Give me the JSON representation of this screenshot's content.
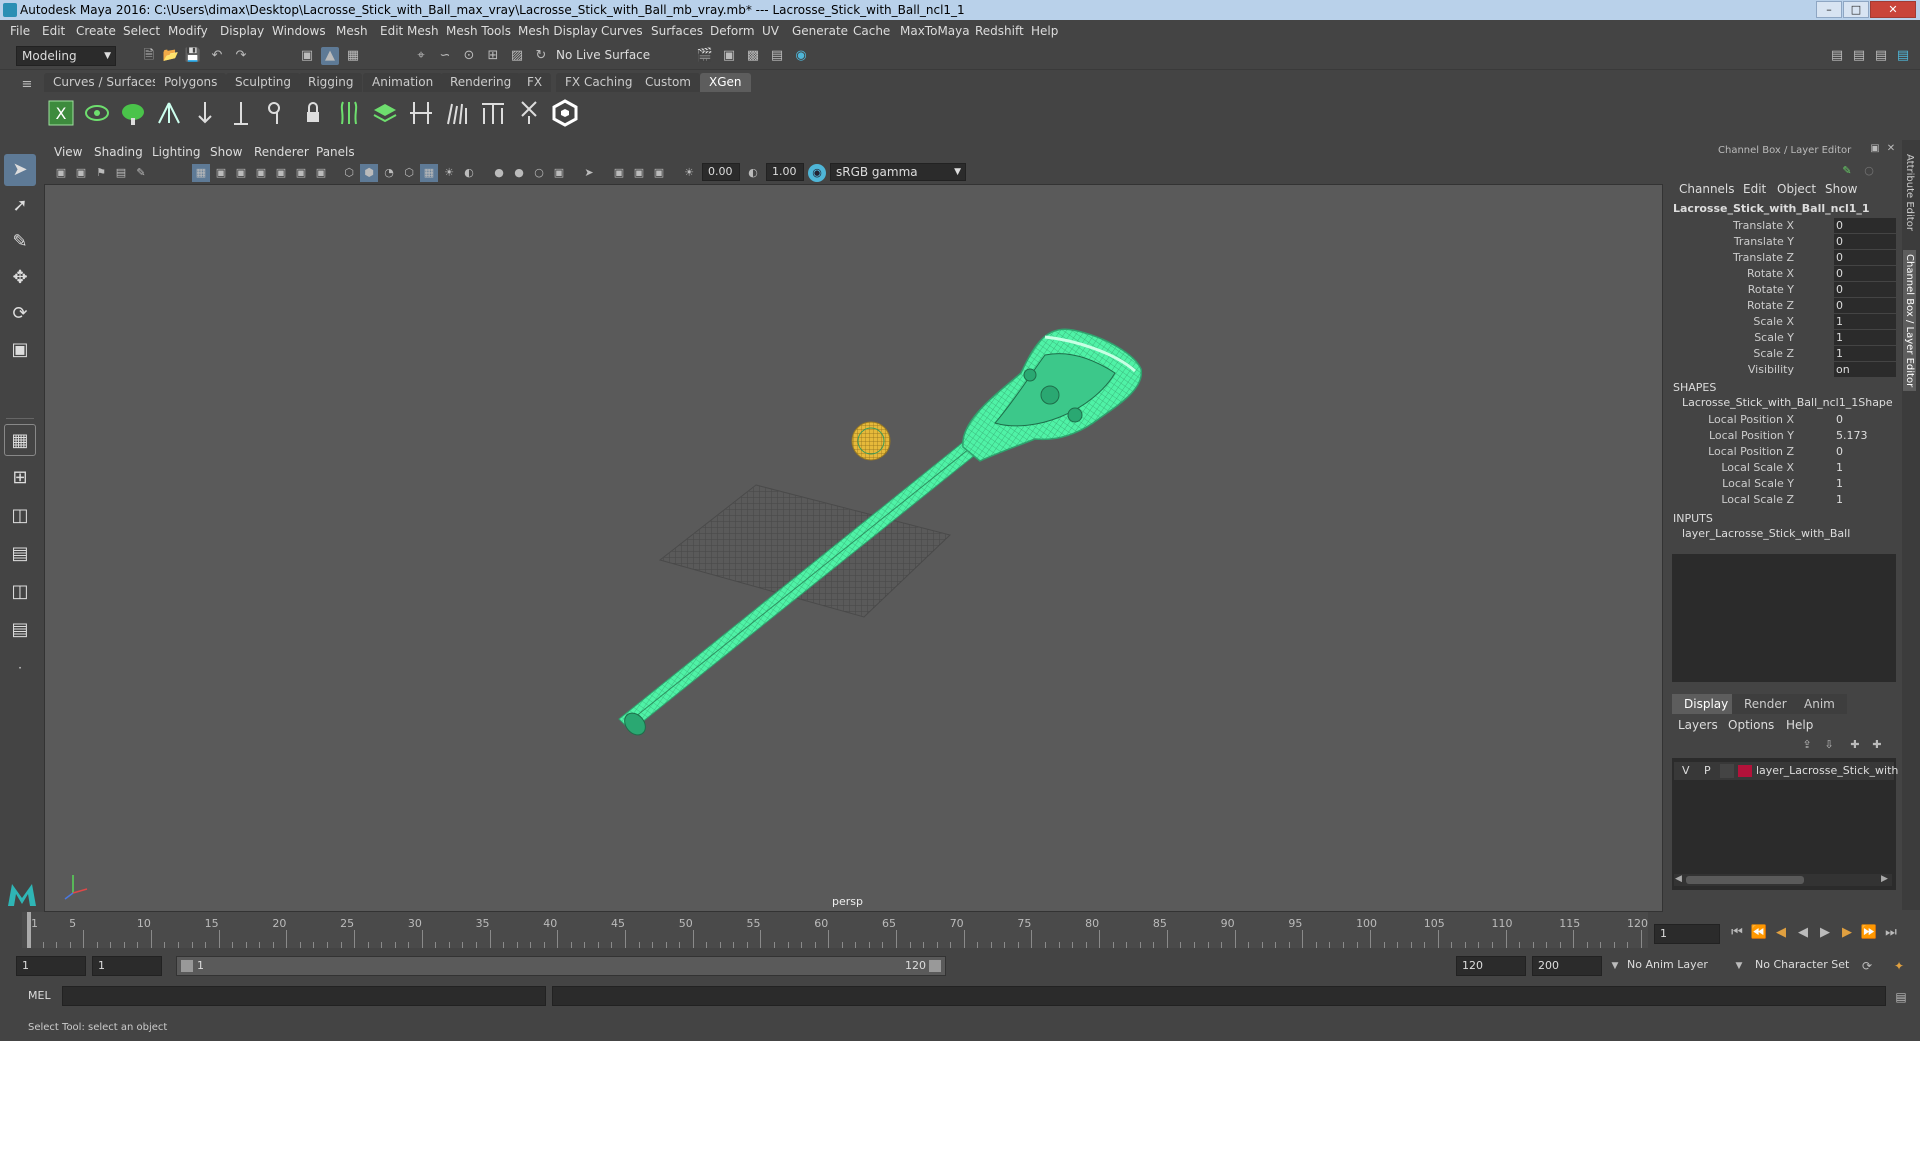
{
  "window": {
    "title": "Autodesk Maya 2016: C:\\Users\\dimax\\Desktop\\Lacrosse_Stick_with_Ball_max_vray\\Lacrosse_Stick_with_Ball_mb_vray.mb*   ---   Lacrosse_Stick_with_Ball_ncl1_1"
  },
  "menu": [
    "File",
    "Edit",
    "Create",
    "Select",
    "Modify",
    "Display",
    "Windows",
    "Mesh",
    "Edit Mesh",
    "Mesh Tools",
    "Mesh Display",
    "Curves",
    "Surfaces",
    "Deform",
    "UV",
    "Generate",
    "Cache",
    "MaxToMaya",
    "Redshift",
    "Help"
  ],
  "statusline": {
    "mode": "Modeling",
    "live_surface": "No Live Surface"
  },
  "shelf_tabs": [
    "Curves / Surfaces",
    "Polygons",
    "Sculpting",
    "Rigging",
    "Animation",
    "Rendering",
    "FX",
    "FX Caching",
    "Custom",
    "XGen"
  ],
  "shelf_active": "XGen",
  "panel_menu": [
    "View",
    "Shading",
    "Lighting",
    "Show",
    "Renderer",
    "Panels"
  ],
  "panel_toolbar": {
    "exposure": "0.00",
    "gamma": "1.00",
    "color_space": "sRGB gamma"
  },
  "viewport": {
    "camera_label": "persp"
  },
  "channel_box": {
    "header": "Channel Box / Layer Editor",
    "menus": [
      "Channels",
      "Edit",
      "Object",
      "Show"
    ],
    "object_name": "Lacrosse_Stick_with_Ball_ncl1_1",
    "channels": [
      {
        "label": "Translate X",
        "value": "0"
      },
      {
        "label": "Translate Y",
        "value": "0"
      },
      {
        "label": "Translate Z",
        "value": "0"
      },
      {
        "label": "Rotate X",
        "value": "0"
      },
      {
        "label": "Rotate Y",
        "value": "0"
      },
      {
        "label": "Rotate Z",
        "value": "0"
      },
      {
        "label": "Scale X",
        "value": "1"
      },
      {
        "label": "Scale Y",
        "value": "1"
      },
      {
        "label": "Scale Z",
        "value": "1"
      },
      {
        "label": "Visibility",
        "value": "on"
      }
    ],
    "shapes_header": "SHAPES",
    "shape_name": "Lacrosse_Stick_with_Ball_ncl1_1Shape",
    "shape_channels": [
      {
        "label": "Local Position X",
        "value": "0"
      },
      {
        "label": "Local Position Y",
        "value": "5.173"
      },
      {
        "label": "Local Position Z",
        "value": "0"
      },
      {
        "label": "Local Scale X",
        "value": "1"
      },
      {
        "label": "Local Scale Y",
        "value": "1"
      },
      {
        "label": "Local Scale Z",
        "value": "1"
      }
    ],
    "inputs_header": "INPUTS",
    "input_name": "layer_Lacrosse_Stick_with_Ball"
  },
  "layer_editor": {
    "tabs": [
      "Display",
      "Render",
      "Anim"
    ],
    "active_tab": "Display",
    "menus": [
      "Layers",
      "Options",
      "Help"
    ],
    "layer": {
      "v": "V",
      "p": "P",
      "name": "layer_Lacrosse_Stick_with",
      "color": "#b3123a"
    }
  },
  "side_tabs": [
    "Attribute Editor",
    "Channel Box / Layer Editor"
  ],
  "timeline": {
    "ticks": [
      1,
      5,
      10,
      15,
      20,
      25,
      30,
      35,
      40,
      45,
      50,
      55,
      60,
      65,
      70,
      75,
      80,
      85,
      90,
      95,
      100,
      105,
      110,
      115,
      120
    ],
    "current_frame": "1",
    "min": 1,
    "max": 120
  },
  "range": {
    "start": "1",
    "playback_start": "1",
    "slider_start": "1",
    "slider_end": "120",
    "playback_end": "120",
    "end": "200",
    "anim_layer": "No Anim Layer",
    "char_set": "No Character Set"
  },
  "command": {
    "lang": "MEL"
  },
  "help_line": "Select Tool: select an object",
  "colors": {
    "wire": "#4ff2a6",
    "ball": "#e6b93a",
    "bg": "#444444",
    "viewport": "#5a5a5a"
  }
}
